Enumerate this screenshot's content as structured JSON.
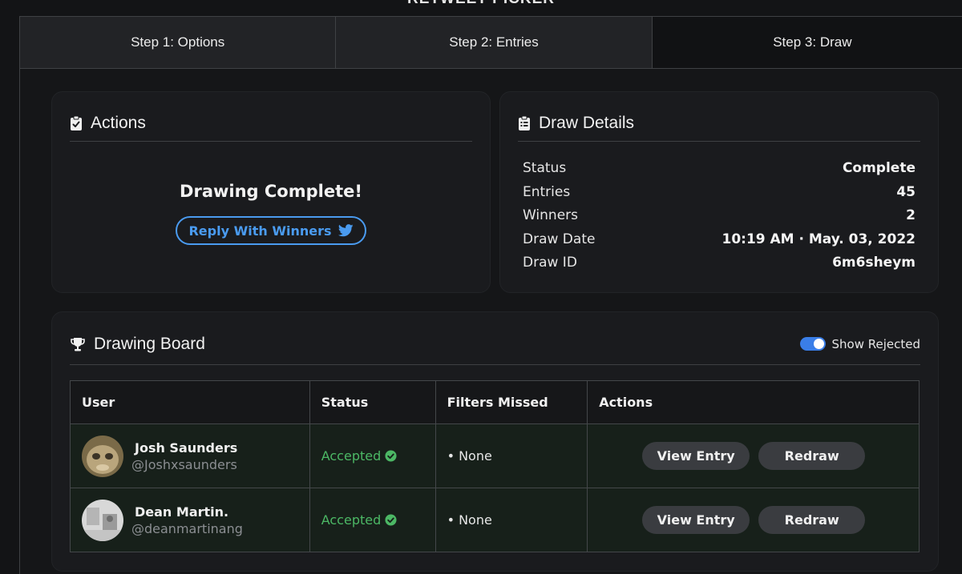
{
  "app": {
    "title": "RETWEET PICKER"
  },
  "tabs": [
    {
      "label": "Step 1: Options"
    },
    {
      "label": "Step 2: Entries"
    },
    {
      "label": "Step 3: Draw"
    }
  ],
  "actions": {
    "title": "Actions",
    "message": "Drawing Complete!",
    "reply_label": "Reply With Winners"
  },
  "details": {
    "title": "Draw Details",
    "rows": [
      {
        "key": "Status",
        "value": "Complete"
      },
      {
        "key": "Entries",
        "value": "45"
      },
      {
        "key": "Winners",
        "value": "2"
      },
      {
        "key": "Draw Date",
        "value": "10:19 AM · May. 03, 2022"
      },
      {
        "key": "Draw ID",
        "value": "6m6sheym"
      }
    ]
  },
  "board": {
    "title": "Drawing Board",
    "toggle_label": "Show Rejected",
    "toggle_on": true,
    "columns": [
      "User",
      "Status",
      "Filters Missed",
      "Actions"
    ],
    "rows": [
      {
        "name": "Josh Saunders",
        "handle": "@Joshxsaunders",
        "status": "Accepted",
        "filters": "• None",
        "view_label": "View Entry",
        "redraw_label": "Redraw"
      },
      {
        "name": "Dean Martin.",
        "handle": "@deanmartinang",
        "status": "Accepted",
        "filters": "• None",
        "view_label": "View Entry",
        "redraw_label": "Redraw"
      }
    ]
  },
  "colors": {
    "accent_blue": "#4a9bf0",
    "accepted_green": "#4cb865",
    "toggle_blue": "#3a7ee8"
  }
}
